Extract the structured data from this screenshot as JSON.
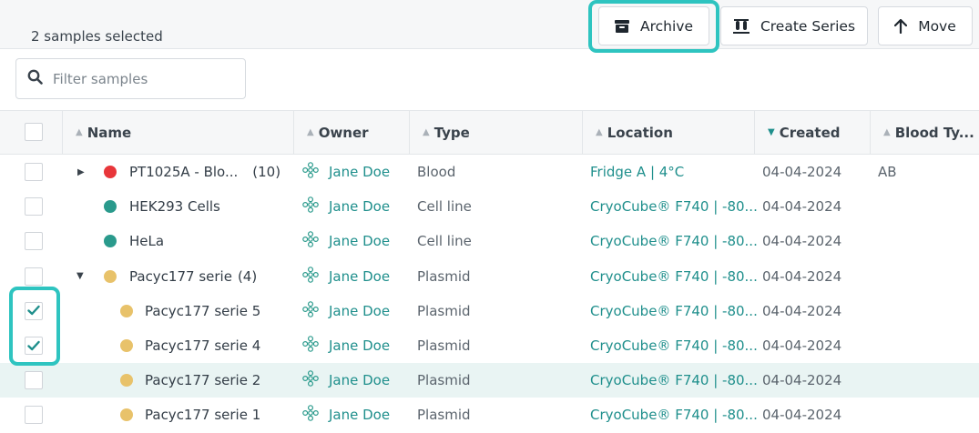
{
  "toolbar": {
    "selection_count": "2 samples selected",
    "archive_label": "Archive",
    "create_series_label": "Create Series",
    "move_label": "Move"
  },
  "filter": {
    "placeholder": "Filter samples",
    "value": ""
  },
  "table": {
    "columns": {
      "name": "Name",
      "owner": "Owner",
      "type": "Type",
      "location": "Location",
      "created": "Created",
      "blood_type": "Blood Ty..."
    },
    "sort": {
      "column": "Created",
      "direction": "descending"
    },
    "rows": [
      {
        "name": "PT1025A - Blo...",
        "count": "(10)",
        "dot_color": "#e8363a",
        "expandable": "collapsed",
        "owner": "Jane Doe",
        "type": "Blood",
        "location": "Fridge A | 4°C",
        "created": "04-04-2024",
        "blood_type": "AB",
        "checked": false
      },
      {
        "name": "HEK293 Cells",
        "count": "",
        "dot_color": "#2a9a8c",
        "expandable": "none",
        "owner": "Jane Doe",
        "type": "Cell line",
        "location": "CryoCube® F740 | -80...",
        "created": "04-04-2024",
        "blood_type": "",
        "checked": false
      },
      {
        "name": "HeLa",
        "count": "",
        "dot_color": "#2a9a8c",
        "expandable": "none",
        "owner": "Jane Doe",
        "type": "Cell line",
        "location": "CryoCube® F740 | -80...",
        "created": "04-04-2024",
        "blood_type": "",
        "checked": false
      },
      {
        "name": "Pacyc177 serie",
        "count": "(4)",
        "dot_color": "#e8c26a",
        "expandable": "expanded",
        "owner": "Jane Doe",
        "type": "Plasmid",
        "location": "CryoCube® F740 | -80...",
        "created": "04-04-2024",
        "blood_type": "",
        "checked": false
      },
      {
        "name": "Pacyc177 serie 5",
        "count": "",
        "dot_color": "#e8c26a",
        "expandable": "child",
        "owner": "Jane Doe",
        "type": "Plasmid",
        "location": "CryoCube® F740 | -80...",
        "created": "04-04-2024",
        "blood_type": "",
        "checked": true
      },
      {
        "name": "Pacyc177 serie 4",
        "count": "",
        "dot_color": "#e8c26a",
        "expandable": "child",
        "owner": "Jane Doe",
        "type": "Plasmid",
        "location": "CryoCube® F740 | -80...",
        "created": "04-04-2024",
        "blood_type": "",
        "checked": true
      },
      {
        "name": "Pacyc177 serie 2",
        "count": "",
        "dot_color": "#e8c26a",
        "expandable": "child",
        "owner": "Jane Doe",
        "type": "Plasmid",
        "location": "CryoCube® F740 | -80...",
        "created": "04-04-2024",
        "blood_type": "",
        "checked": false,
        "hovered": true
      },
      {
        "name": "Pacyc177 serie 1",
        "count": "",
        "dot_color": "#e8c26a",
        "expandable": "child",
        "owner": "Jane Doe",
        "type": "Plasmid",
        "location": "CryoCube® F740 | -80...",
        "created": "04-04-2024",
        "blood_type": "",
        "checked": false
      }
    ]
  },
  "colors": {
    "accent": "#1f8f8c",
    "highlight": "#2ec4c0",
    "hover_row": "#e9f4f3"
  },
  "icons": [
    "archive-box-icon",
    "create-series-tubes-icon",
    "arrow-up-icon",
    "search-icon",
    "sort-icon",
    "owner-avatar-icon",
    "expand-caret-icon",
    "checkmark-icon"
  ]
}
